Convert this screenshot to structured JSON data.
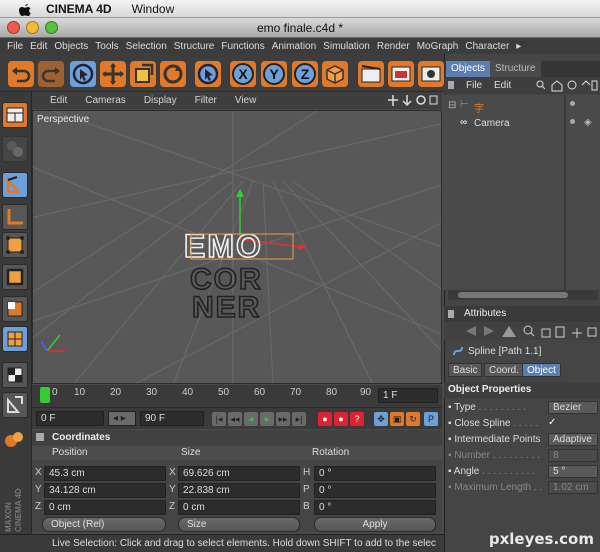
{
  "macos": {
    "app_name": "CINEMA 4D",
    "menu_window": "Window"
  },
  "window": {
    "title": "emo finale.c4d *"
  },
  "menubar": [
    "File",
    "Edit",
    "Objects",
    "Tools",
    "Selection",
    "Structure",
    "Functions",
    "Animation",
    "Simulation",
    "Render",
    "MoGraph",
    "Character",
    "▸"
  ],
  "viewport": {
    "menu": [
      "Edit",
      "Cameras",
      "Display",
      "Filter",
      "View"
    ],
    "label": "Perspective",
    "text_lines": [
      "EMO",
      "COR",
      "NER"
    ]
  },
  "timeline": {
    "ticks": [
      "0",
      "10",
      "20",
      "30",
      "40",
      "50",
      "60",
      "70",
      "80",
      "90"
    ],
    "frame_field": "1 F"
  },
  "transport": {
    "start": "0 F",
    "end": "90 F"
  },
  "coordinates": {
    "title": "Coordinates",
    "headers": [
      "Position",
      "Size",
      "Rotation"
    ],
    "rows": [
      {
        "axis": "X",
        "pos": "45.3 cm",
        "size_axis": "X",
        "size": "69.626 cm",
        "rot_axis": "H",
        "rot": "0 °"
      },
      {
        "axis": "Y",
        "pos": "34.128 cm",
        "size_axis": "Y",
        "size": "22.838 cm",
        "rot_axis": "P",
        "rot": "0 °"
      },
      {
        "axis": "Z",
        "pos": "0 cm",
        "size_axis": "Z",
        "size": "0 cm",
        "rot_axis": "B",
        "rot": "0 °"
      }
    ],
    "mode": "Object (Rel)",
    "size_mode": "Size",
    "apply": "Apply"
  },
  "brand": "MAXON CINEMA 4D",
  "status": "Live Selection: Click and drag to select elements. Hold down SHIFT to add to the selec",
  "objects_panel": {
    "tabs": [
      "Objects",
      "Structure"
    ],
    "menu": [
      "File",
      "Edit"
    ],
    "items": [
      {
        "name": "字"
      },
      {
        "name": "Camera"
      }
    ]
  },
  "attributes": {
    "title": "Attributes",
    "object": "Spline [Path 1.1]",
    "tabs": [
      "Basic",
      "Coord.",
      "Object"
    ],
    "section": "Object Properties",
    "props": [
      {
        "label": "Type",
        "value": "Bezier"
      },
      {
        "label": "Close Spline",
        "value": "✓"
      },
      {
        "label": "Intermediate Points",
        "value": "Adaptive"
      },
      {
        "label": "Number",
        "value": "8"
      },
      {
        "label": "Angle",
        "value": "5 °"
      },
      {
        "label": "Maximum Length",
        "value": "1.02 cm"
      }
    ]
  },
  "watermark": "pxleyes.com",
  "colors": {
    "accent_orange": "#e8822a",
    "selected_blue": "#6da0d8",
    "axis_red": "#e03030",
    "axis_green": "#33cc33",
    "axis_blue": "#4466ff"
  }
}
